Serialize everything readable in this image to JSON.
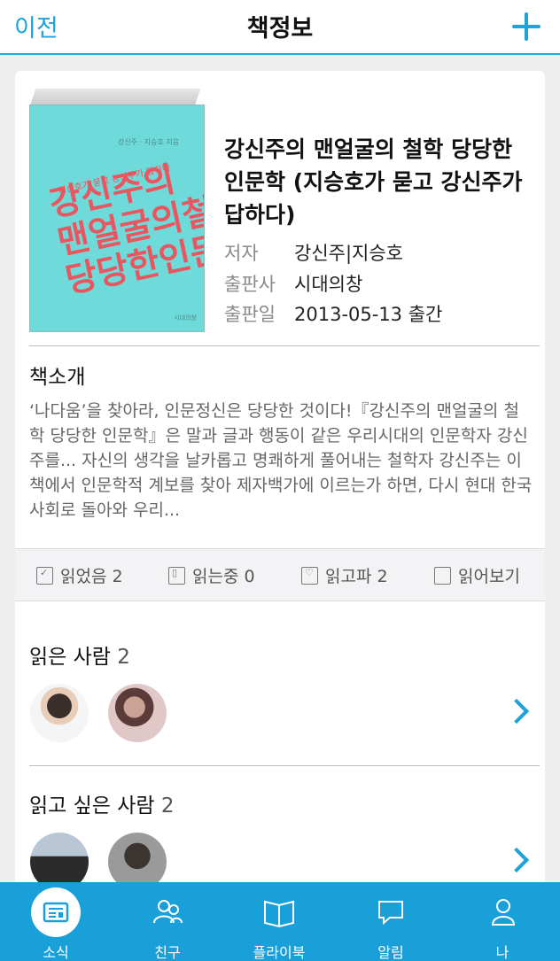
{
  "nav": {
    "back_label": "이전",
    "title": "책정보"
  },
  "book": {
    "cover": {
      "line1": "강신주의",
      "line2": "맨얼굴의철학",
      "line3": "당당한인문학",
      "tagline": "지승호가 묻고 강신주가 답하다",
      "authors": "강신주 · 지승호 지음",
      "publisher": "시대의창"
    },
    "title": "강신주의 맨얼굴의 철학 당당한 인문학 (지승호가 묻고 강신주가 답하다)",
    "meta": [
      {
        "key": "저자",
        "value": "강신주|지승호"
      },
      {
        "key": "출판사",
        "value": "시대의창"
      },
      {
        "key": "출판일",
        "value": "2013-05-13 출간"
      }
    ]
  },
  "intro": {
    "heading": "책소개",
    "text": "‘나다움’을 찾아라, 인문정신은 당당한 것이다!『강신주의 맨얼굴의 철학 당당한 인문학』은 말과 글과 행동이 같은 우리시대의 인문학자 강신주를... 자신의 생각을 날카롭고 명쾌하게 풀어내는 철학자 강신주는 이 책에서 인문학적 계보를 찾아 제자백가에 이르는가 하면, 다시 현대 한국 사회로 돌아와 우리..."
  },
  "stats": [
    {
      "label": "읽었음 2",
      "icon": "check-box-icon"
    },
    {
      "label": "읽는중 0",
      "icon": "bookmark-box-icon"
    },
    {
      "label": "읽고파 2",
      "icon": "heart-box-icon"
    },
    {
      "label": "읽어보기",
      "icon": "page-icon"
    }
  ],
  "readers": {
    "title": "읽은 사람",
    "count": "2"
  },
  "wishers": {
    "title": "읽고 싶은 사람",
    "count": "2"
  },
  "tabs": [
    {
      "label": "소식",
      "icon": "news-icon",
      "active": true
    },
    {
      "label": "친구",
      "icon": "friends-icon",
      "active": false
    },
    {
      "label": "플라이북",
      "icon": "book-icon",
      "active": false
    },
    {
      "label": "알림",
      "icon": "chat-bubble-icon",
      "active": false
    },
    {
      "label": "나",
      "icon": "person-icon",
      "active": false
    }
  ],
  "colors": {
    "accent": "#1ea2dc",
    "cover_bg": "#6fdada",
    "cover_text": "#e9565f"
  }
}
